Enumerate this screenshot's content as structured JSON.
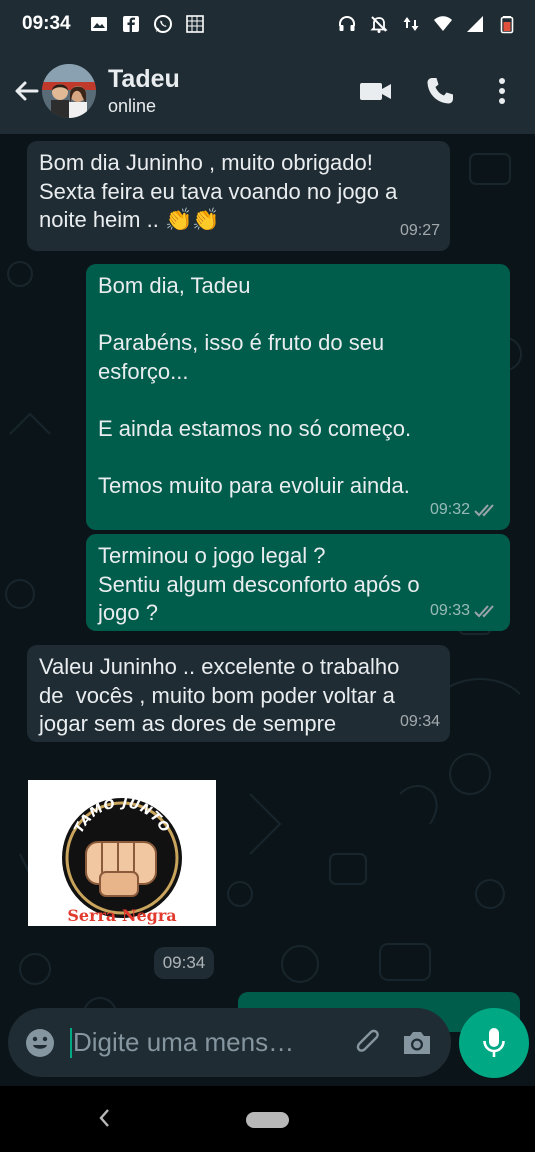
{
  "status_bar": {
    "time": "09:34",
    "left_icons": [
      "image-icon",
      "facebook-icon",
      "whatsapp-icon",
      "grid-icon"
    ],
    "right_icons": [
      "headset-icon",
      "bell-off-icon",
      "data-arrows-icon",
      "wifi-icon",
      "signal-icon",
      "battery-icon"
    ]
  },
  "header": {
    "contact_name": "Tadeu",
    "contact_status": "online",
    "actions": [
      "video-call-icon",
      "phone-icon",
      "more-vert-icon"
    ]
  },
  "messages": [
    {
      "direction": "in",
      "text": "Bom dia Juninho , muito obrigado!\nSexta feira eu tava voando no jogo a\nnoite heim .. 👏👏",
      "time": "09:27"
    },
    {
      "direction": "out",
      "text": "Bom dia, Tadeu\n\nParabéns, isso é fruto do seu\nesforço...\n\nE ainda estamos no só começo.\n\nTemos muito para evoluir ainda.",
      "time": "09:32",
      "status": "read"
    },
    {
      "direction": "out",
      "text": "Terminou o jogo legal ?\nSentiu algum desconforto após o\njogo ?",
      "time": "09:33",
      "status": "read"
    },
    {
      "direction": "in",
      "text": "Valeu Juninho .. excelente o trabalho\nde  vocês , muito bom poder voltar a\njogar sem as dores de sempre",
      "time": "09:34"
    }
  ],
  "image_message": {
    "logo_top_text": "TAMO JUNTO",
    "logo_bottom_text": "Serra Negra",
    "time": "09:34"
  },
  "composer": {
    "placeholder": "Digite uma mens…",
    "icons": [
      "emoji-icon",
      "attach-icon",
      "camera-icon",
      "mic-icon"
    ]
  },
  "colors": {
    "incoming": "#1f2c33",
    "outgoing": "#005c4b",
    "accent": "#00a884",
    "read_ticks": "#9aa4aa"
  }
}
